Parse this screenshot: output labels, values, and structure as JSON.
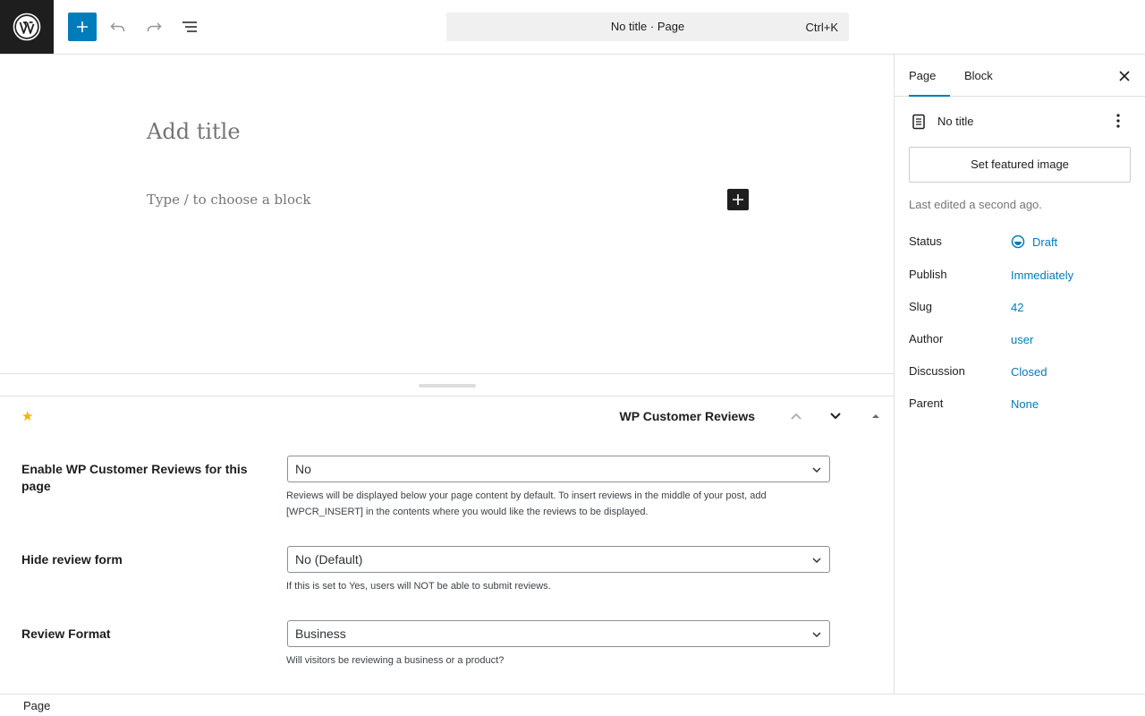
{
  "toolbar": {
    "command_title": "No title · Page",
    "command_shortcut": "Ctrl+K"
  },
  "icons": {
    "logo": "wordpress-logo-icon",
    "add": "plus-icon",
    "undo": "undo-icon",
    "redo": "redo-icon",
    "list_view": "list-view-icon"
  },
  "canvas": {
    "title_placeholder": "Add title",
    "block_placeholder": "Type / to choose a block"
  },
  "metabox": {
    "title": "WP Customer Reviews",
    "rows": [
      {
        "label": "Enable WP Customer Reviews for this page",
        "value": "No",
        "hint": "Reviews will be displayed below your page content by default. To insert reviews in the middle of your post, add [WPCR_INSERT] in the contents where you would like the reviews to be displayed."
      },
      {
        "label": "Hide review form",
        "value": "No (Default)",
        "hint": "If this is set to Yes, users will NOT be able to submit reviews."
      },
      {
        "label": "Review Format",
        "value": "Business",
        "hint": "Will visitors be reviewing a business or a product?"
      }
    ]
  },
  "sidebar": {
    "tabs": [
      {
        "label": "Page",
        "active": true
      },
      {
        "label": "Block",
        "active": false
      }
    ],
    "doc_title": "No title",
    "featured_button": "Set featured image",
    "last_edited": "Last edited a second ago.",
    "fields": [
      {
        "label": "Status",
        "value": "Draft"
      },
      {
        "label": "Publish",
        "value": "Immediately"
      },
      {
        "label": "Slug",
        "value": "42"
      },
      {
        "label": "Author",
        "value": "user"
      },
      {
        "label": "Discussion",
        "value": "Closed"
      },
      {
        "label": "Parent",
        "value": "None"
      }
    ]
  },
  "footer": {
    "breadcrumb": "Page"
  },
  "colors": {
    "accent": "#007cba",
    "dark": "#1e1e1e"
  }
}
